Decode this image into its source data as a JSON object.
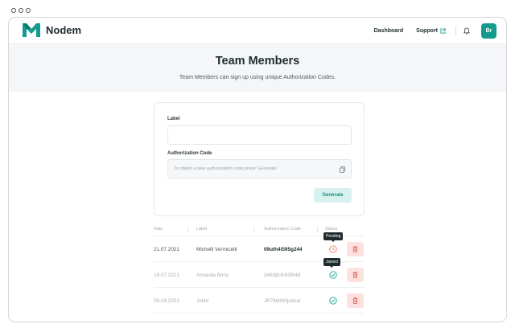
{
  "app": {
    "name": "Nodem",
    "brand_color": "#139b8e"
  },
  "nav": {
    "dashboard_label": "Dashboard",
    "support_label": "Support",
    "avatar_initials": "Br"
  },
  "hero": {
    "title": "Team Members",
    "subtitle": "Team Members can sign up using unique Authorization Codes."
  },
  "form": {
    "label_field": {
      "label": "Label",
      "value": "",
      "placeholder": ""
    },
    "code_field": {
      "label": "Authorization Code",
      "placeholder": "To obtain a new authorization code press 'Generate'"
    },
    "generate_label": "Generate"
  },
  "table": {
    "columns": [
      "Date",
      "Label",
      "Authorization Code",
      "Status"
    ],
    "rows": [
      {
        "date": "21.07.2021",
        "label": "Michelli Vermicelli",
        "code": "09uth4i595g244",
        "status": "Pending",
        "tooltip": "Pending"
      },
      {
        "date": "18.07.2021",
        "label": "Amanda Brrra",
        "code": "3463jfcih93fh48",
        "status": "Joined",
        "tooltip": "Joined"
      },
      {
        "date": "09.04.2021",
        "label": "Jolan",
        "code": "JK786000jsduui",
        "status": "Joined",
        "tooltip": ""
      }
    ]
  },
  "colors": {
    "pending": "#e8846a",
    "joined": "#1fa08f",
    "delete_bg": "#fde1df",
    "delete_icon": "#e0584f"
  },
  "icons": [
    "logo-icon",
    "external-link-icon",
    "bell-icon",
    "copy-icon",
    "clock-icon",
    "check-circle-icon",
    "trash-icon"
  ]
}
